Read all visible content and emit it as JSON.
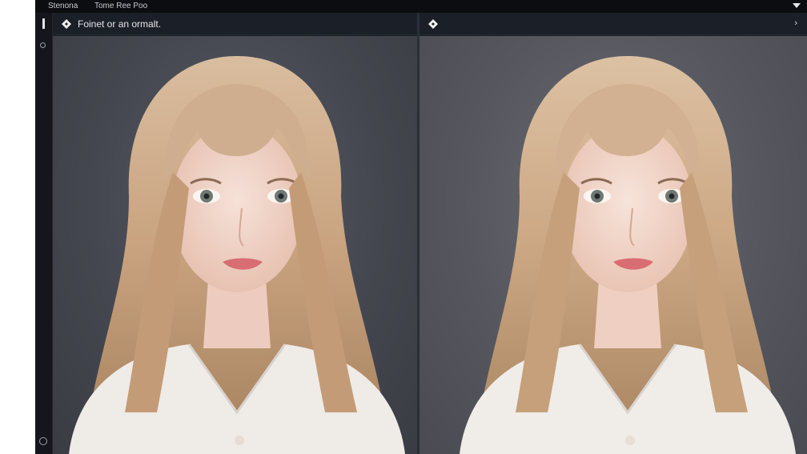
{
  "menubar": {
    "items": [
      "Stenona",
      "Tome Ree Poo"
    ]
  },
  "panels": {
    "left": {
      "title": "Foinet or an ormalt."
    },
    "right": {
      "title": ""
    }
  },
  "icons": {
    "menu_caret": "caret-down-icon",
    "panel_diamond": "diamond-icon",
    "panel_chevron": "chevron-right-icon",
    "tool_bar": "bar-icon",
    "tool_ring": "ring-icon",
    "tool_add": "plus-circle-icon"
  },
  "colors": {
    "app_bg": "#111318",
    "panel_header": "#1b1f27",
    "hair": "#cfae8f",
    "skin": "#f1d7cc",
    "shirt": "#eeeae6"
  }
}
